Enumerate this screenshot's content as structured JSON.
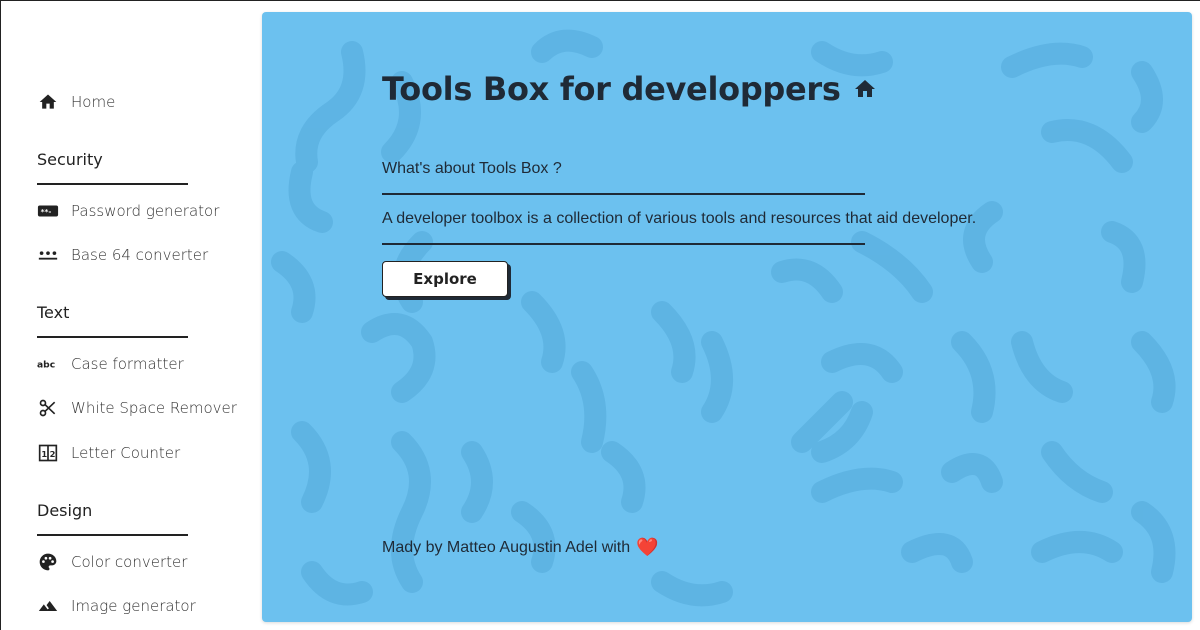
{
  "sidebar": {
    "home": {
      "label": "Home",
      "icon": "home-icon"
    },
    "sections": [
      {
        "title": "Security",
        "items": [
          {
            "label": "Password generator",
            "icon": "password-icon"
          },
          {
            "label": "Base 64 converter",
            "icon": "dots-icon"
          }
        ]
      },
      {
        "title": "Text",
        "items": [
          {
            "label": "Case formatter",
            "icon": "abc-icon"
          },
          {
            "label": "White Space Remover",
            "icon": "scissors-icon"
          },
          {
            "label": "Letter Counter",
            "icon": "counter-icon"
          }
        ]
      },
      {
        "title": "Design",
        "items": [
          {
            "label": "Color converter",
            "icon": "palette-icon"
          },
          {
            "label": "Image generator",
            "icon": "image-icon"
          }
        ]
      }
    ]
  },
  "main": {
    "title": "Tools Box for developpers",
    "about_heading": "What's about Tools Box ?",
    "description": "A developer toolbox is a collection of various tools and resources that aid developer.",
    "explore_label": "Explore",
    "footer_text": "Mady by Matteo Augustin Adel with",
    "heart": "❤️",
    "background_color": "#6cc1ef"
  }
}
